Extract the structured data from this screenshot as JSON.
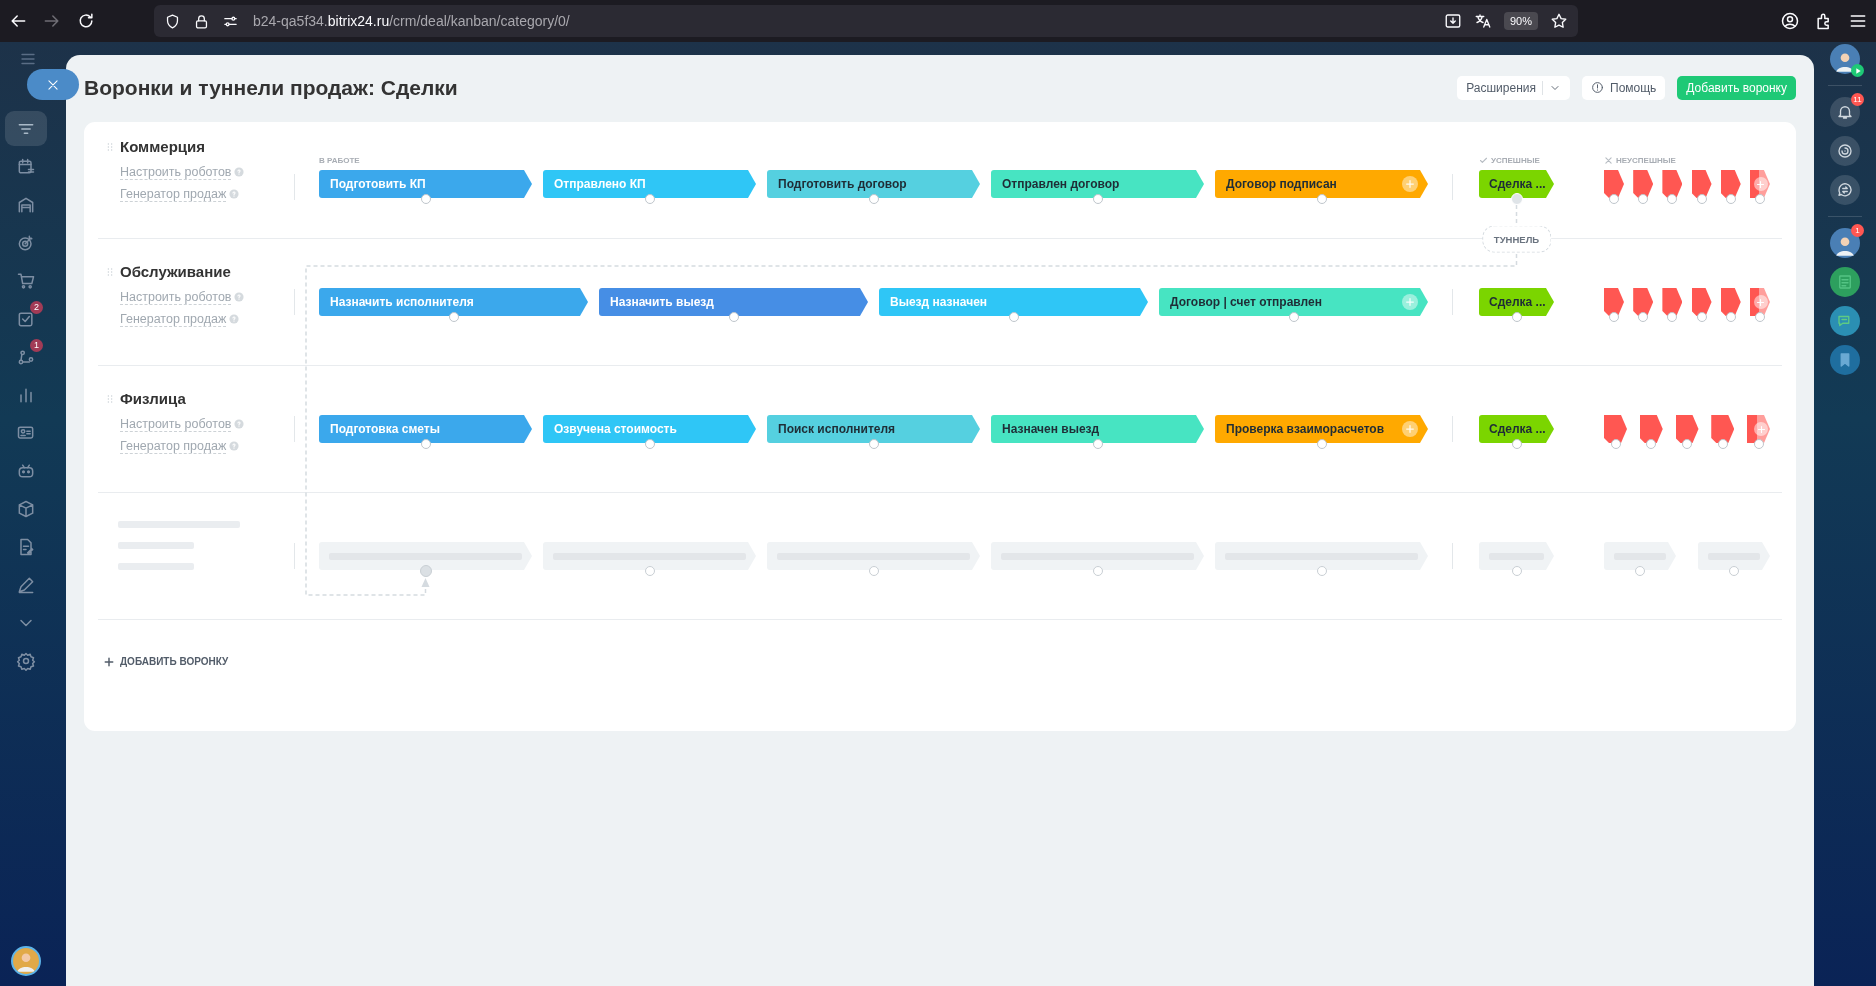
{
  "browser": {
    "url_subdomain": "b24-qa5f34.",
    "url_domain": "bitrix24.ru",
    "url_path": "/crm/deal/kanban/category/0/",
    "zoom": "90%"
  },
  "left_sidebar": {
    "items": [
      {
        "kind": "filter",
        "selected": true
      },
      {
        "kind": "calendar",
        "selected": false
      },
      {
        "kind": "garage",
        "selected": false
      },
      {
        "kind": "target",
        "selected": false
      },
      {
        "kind": "cart",
        "selected": false
      },
      {
        "kind": "tasks",
        "selected": false,
        "badge": "2"
      },
      {
        "kind": "flow",
        "selected": false,
        "badge": "1"
      },
      {
        "kind": "chart",
        "selected": false
      },
      {
        "kind": "contact",
        "selected": false
      },
      {
        "kind": "robot",
        "selected": false
      },
      {
        "kind": "box",
        "selected": false
      },
      {
        "kind": "document",
        "selected": false
      },
      {
        "kind": "pen",
        "selected": false
      },
      {
        "kind": "more",
        "selected": false
      },
      {
        "kind": "settings",
        "selected": false
      }
    ]
  },
  "page": {
    "title": "Воронки и туннели продаж: Сделки",
    "extensions_button": "Расширения",
    "help_button": "Помощь",
    "add_button": "Добавить воронку"
  },
  "columns": {
    "in_work": "В РАБОТЕ",
    "success": "УСПЕШНЫЕ",
    "failed": "НЕУСПЕШНЫЕ"
  },
  "funnels": [
    {
      "name": "Коммерция",
      "links": [
        "Настроить роботов",
        "Генератор продаж"
      ],
      "stages": [
        {
          "name": "Подготовить КП",
          "color": "#3ba8ec",
          "add_button": false
        },
        {
          "name": "Отправлено КП",
          "color": "#2fc6f6",
          "add_button": false
        },
        {
          "name": "Подготовить договор",
          "color": "#55d0e0",
          "add_button": false
        },
        {
          "name": "Отправлен договор",
          "color": "#47e4c2",
          "add_button": false
        },
        {
          "name": "Договор подписан",
          "color": "#ffa900",
          "add_button": true
        }
      ],
      "success": {
        "name": "Сделка ...",
        "color": "#7bd500",
        "tunnel": {
          "label": "ТУННЕЛЬ"
        }
      },
      "failed": [
        {
          "kind": "stage"
        },
        {
          "kind": "stage"
        },
        {
          "kind": "stage"
        },
        {
          "kind": "stage"
        },
        {
          "kind": "stage"
        },
        {
          "kind": "add"
        }
      ]
    },
    {
      "name": "Обслуживание",
      "links": [
        "Настроить роботов",
        "Генератор продаж"
      ],
      "stages": [
        {
          "name": "Назначить исполнителя",
          "color": "#3ba8ec",
          "add_button": false
        },
        {
          "name": "Назначить выезд",
          "color": "#468ee5",
          "add_button": false
        },
        {
          "name": "Выезд назначен",
          "color": "#2fc6f6",
          "add_button": false
        },
        {
          "name": "Договор | счет отправлен",
          "color": "#47e4c2",
          "add_button": true
        }
      ],
      "success": {
        "name": "Сделка ...",
        "color": "#7bd500"
      },
      "failed": [
        {
          "kind": "stage"
        },
        {
          "kind": "stage"
        },
        {
          "kind": "stage"
        },
        {
          "kind": "stage"
        },
        {
          "kind": "stage"
        },
        {
          "kind": "add"
        }
      ]
    },
    {
      "name": "Физлица",
      "links": [
        "Настроить роботов",
        "Генератор продаж"
      ],
      "stages": [
        {
          "name": "Подготовка сметы",
          "color": "#3ba8ec",
          "add_button": false
        },
        {
          "name": "Озвучена стоимость",
          "color": "#2fc6f6",
          "add_button": false
        },
        {
          "name": "Поиск исполнителя",
          "color": "#55d0e0",
          "add_button": false
        },
        {
          "name": "Назначен выезд",
          "color": "#47e4c2",
          "add_button": false
        },
        {
          "name": "Проверка взаиморасчетов",
          "color": "#ffa900",
          "add_button": true
        }
      ],
      "success": {
        "name": "Сделка ...",
        "color": "#7bd500"
      },
      "failed": [
        {
          "kind": "stage"
        },
        {
          "kind": "stage"
        },
        {
          "kind": "stage"
        },
        {
          "kind": "stage"
        },
        {
          "kind": "add"
        }
      ]
    }
  ],
  "new_funnel_placeholder": true,
  "add_funnel_link": "ДОБАВИТЬ ВОРОНКУ",
  "right_sidebar": {
    "items": [
      {
        "kind": "avatar",
        "status": true
      },
      {
        "kind": "bell",
        "badge": "11"
      },
      {
        "kind": "spiral"
      },
      {
        "kind": "chat-sync"
      },
      {
        "kind": "avatar",
        "badge": "1"
      },
      {
        "kind": "notes"
      },
      {
        "kind": "messages"
      },
      {
        "kind": "bookmark"
      }
    ]
  }
}
